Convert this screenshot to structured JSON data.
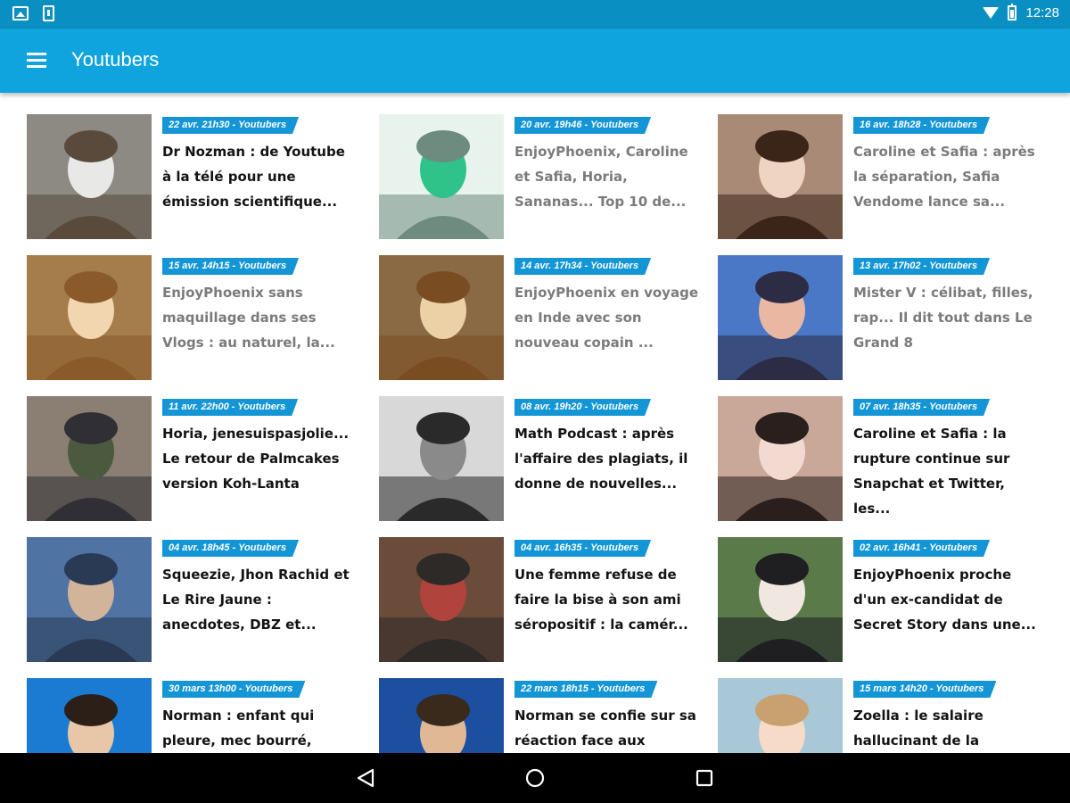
{
  "status_bar": {
    "left_icons": [
      "image-notification-icon",
      "phone-notification-icon"
    ],
    "right_icons": [
      "wifi-icon",
      "battery-icon"
    ],
    "time": "12:28"
  },
  "app_bar": {
    "menu_icon": "hamburger-menu-icon",
    "title": "Youtubers"
  },
  "articles": [
    {
      "tag": "22 avr. 21h30 - Youtubers",
      "title": "Dr Nozman : de Youtube à la télé pour une émission scientifique...",
      "read": false,
      "thumb": "Man in lab coat with glasses"
    },
    {
      "tag": "20 avr. 19h46 - Youtubers",
      "title": "EnjoyPhoenix, Caroline et Safia, Horia, Sananas... Top 10 de...",
      "read": true,
      "thumb": "Ranking list screenshot"
    },
    {
      "tag": "16 avr. 18h28 - Youtubers",
      "title": "Caroline et Safia : après la séparation, Safia Vendome lance sa...",
      "read": true,
      "thumb": "Smiling woman selfie"
    },
    {
      "tag": "15 avr. 14h15 - Youtubers",
      "title": "EnjoyPhoenix sans maquillage dans ses Vlogs : au naturel, la...",
      "read": true,
      "thumb": "Woman on bed"
    },
    {
      "tag": "14 avr. 17h34 - Youtubers",
      "title": "EnjoyPhoenix en voyage en Inde avec son nouveau copain ...",
      "read": true,
      "thumb": "Woman on bed"
    },
    {
      "tag": "13 avr. 17h02 - Youtubers",
      "title": "Mister V : célibat, filles, rap... Il dit tout dans Le Grand 8",
      "read": true,
      "thumb": "TV studio group"
    },
    {
      "tag": "11 avr. 22h00 - Youtubers",
      "title": "Horia, jenesuispasjolie... Le retour de Palmcakes version Koh-Lanta",
      "read": false,
      "thumb": "Group sitting outdoors"
    },
    {
      "tag": "08 avr. 19h20 - Youtubers",
      "title": "Math Podcast : après l'affaire des plagiats, il donne de nouvelles...",
      "read": false,
      "thumb": "Black and white portrait"
    },
    {
      "tag": "07 avr. 18h35 - Youtubers",
      "title": "Caroline et Safia : la rupture continue sur Snapchat et Twitter, les...",
      "read": false,
      "thumb": "Woman with glasses"
    },
    {
      "tag": "04 avr. 18h45 - Youtubers",
      "title": "Squeezie, Jhon Rachid et Le Rire Jaune : anecdotes, DBZ et...",
      "read": false,
      "thumb": "Three men interview"
    },
    {
      "tag": "04 avr. 16h35 - Youtubers",
      "title": "Une femme refuse de faire la bise à son ami séropositif : la camér...",
      "read": false,
      "thumb": "Restaurant terrace"
    },
    {
      "tag": "02 avr. 16h41 - Youtubers",
      "title": "EnjoyPhoenix proche d'un ex-candidat de Secret Story dans une...",
      "read": false,
      "thumb": "Two people with helmets"
    },
    {
      "tag": "30 mars 13h00 - Youtubers",
      "title": "Norman : enfant qui pleure, mec bourré,",
      "read": false,
      "thumb": "Man at Europe 1 studio"
    },
    {
      "tag": "22 mars 18h15 - Youtubers",
      "title": "Norman se confie sur sa réaction face aux",
      "read": false,
      "thumb": "Man at Europe 1 microphone"
    },
    {
      "tag": "15 mars 14h20 - Youtubers",
      "title": "Zoella : le salaire hallucinant de la",
      "read": false,
      "thumb": "Blonde woman portrait"
    }
  ],
  "nav_bar": {
    "icons": [
      "back-triangle-icon",
      "home-circle-icon",
      "recents-square-icon"
    ]
  }
}
